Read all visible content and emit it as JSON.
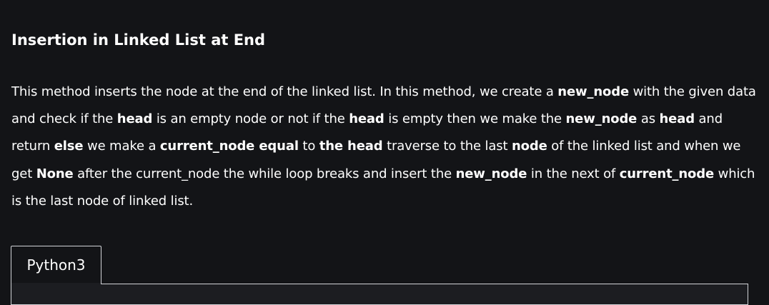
{
  "article": {
    "title": "Insertion in Linked List at End",
    "paragraph": [
      {
        "t": "This method inserts the node at the end of the linked list. In this method, we create a ",
        "b": false
      },
      {
        "t": "new_node",
        "b": true
      },
      {
        "t": " with the given data and check if the ",
        "b": false
      },
      {
        "t": "head",
        "b": true
      },
      {
        "t": " is an empty node or not if the ",
        "b": false
      },
      {
        "t": "head",
        "b": true
      },
      {
        "t": " is empty then we make the ",
        "b": false
      },
      {
        "t": "new_node",
        "b": true
      },
      {
        "t": " as ",
        "b": false
      },
      {
        "t": "head",
        "b": true
      },
      {
        "t": " and return ",
        "b": false
      },
      {
        "t": "else",
        "b": true
      },
      {
        "t": " we make a ",
        "b": false
      },
      {
        "t": "current_node equal",
        "b": true
      },
      {
        "t": " to ",
        "b": false
      },
      {
        "t": "the head",
        "b": true
      },
      {
        "t": " traverse to the last ",
        "b": false
      },
      {
        "t": "node",
        "b": true
      },
      {
        "t": " of the linked list and when we get ",
        "b": false
      },
      {
        "t": "None",
        "b": true
      },
      {
        "t": " after the current_node the while loop breaks and insert the ",
        "b": false
      },
      {
        "t": "new_node",
        "b": true
      },
      {
        "t": " in the next of ",
        "b": false
      },
      {
        "t": "current_node",
        "b": true
      },
      {
        "t": " which is the last node of linked list.",
        "b": false
      }
    ]
  },
  "code_tabs": {
    "active_tab": "Python3"
  }
}
